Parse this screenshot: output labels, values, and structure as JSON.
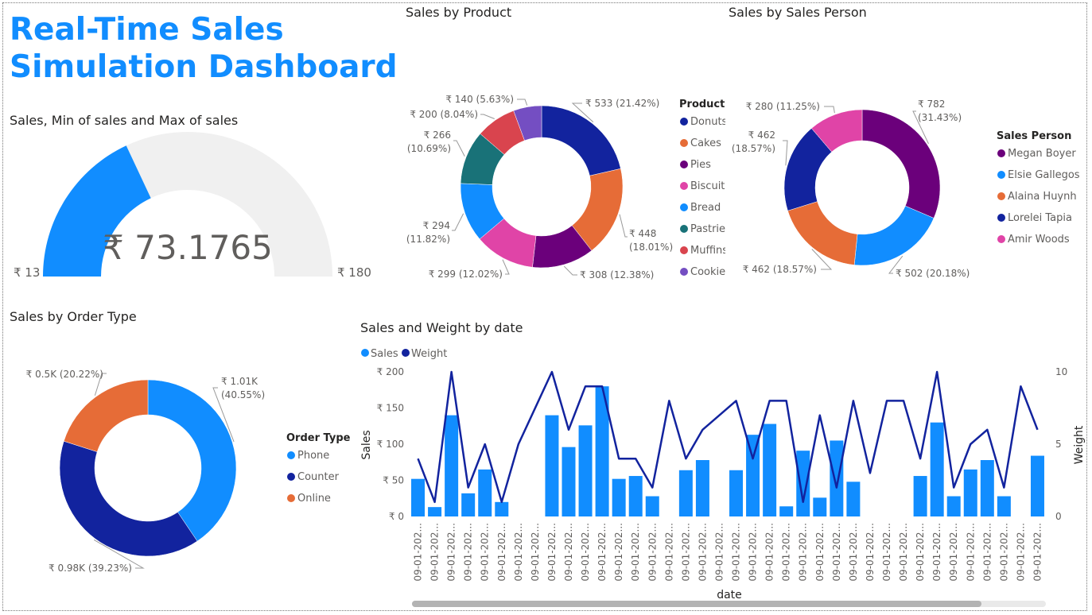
{
  "dashboard": {
    "title_line1": "Real-Time Sales",
    "title_line2": "Simulation Dashboard"
  },
  "visual_titles": {
    "gauge": "Sales, Min of sales and Max of sales",
    "product": "Sales by Product",
    "person": "Sales by Sales Person",
    "order": "Sales by Order Type",
    "combo": "Sales and Weight by date"
  },
  "colors": {
    "accent": "#118DFF",
    "track": "#F0F0F0",
    "title": "#118DFF"
  },
  "chart_data": [
    {
      "type": "gauge",
      "title": "Sales, Min of sales and Max of sales",
      "value": 73.1765,
      "min": 13,
      "max": 180,
      "value_label": "₹ 73.1765",
      "min_label": "₹ 13",
      "max_label": "₹ 180"
    },
    {
      "type": "pie",
      "title": "Sales by Product",
      "legend_title": "Product",
      "legend_position": "right",
      "slices": [
        {
          "name": "Donuts",
          "value": 533,
          "label": "₹ 533 (21.42%)",
          "color": "#12239E"
        },
        {
          "name": "Cakes",
          "value": 448,
          "label": "₹ 448 (18.01%)",
          "color": "#E66C37"
        },
        {
          "name": "Pies",
          "value": 308,
          "label": "₹ 308 (12.38%)",
          "color": "#6B007B"
        },
        {
          "name": "Biscuits",
          "value": 299,
          "label": "₹ 299 (12.02%)",
          "color": "#E044A7"
        },
        {
          "name": "Bread",
          "value": 294,
          "label": "₹ 294 (11.82%)",
          "color": "#118DFF"
        },
        {
          "name": "Pastries",
          "value": 266,
          "label": "₹ 266 (10.69%)",
          "color": "#197278"
        },
        {
          "name": "Muffins",
          "value": 200,
          "label": "₹ 200 (8.04%)",
          "color": "#D9444E"
        },
        {
          "name": "Cookies",
          "value": 140,
          "label": "₹ 140 (5.63%)",
          "color": "#744EC2"
        }
      ],
      "legend_labels": [
        "Donuts",
        "Cakes",
        "Pies",
        "Biscuits",
        "Bread",
        "Pastries",
        "Muffins",
        "Cookie"
      ]
    },
    {
      "type": "pie",
      "title": "Sales by Sales Person",
      "legend_title": "Sales Person",
      "legend_position": "right",
      "slices": [
        {
          "name": "Megan Boyer",
          "value": 782,
          "label": "₹ 782 (31.43%)",
          "color": "#6B007B"
        },
        {
          "name": "Elsie Gallegos",
          "value": 502,
          "label": "₹ 502 (20.18%)",
          "color": "#118DFF"
        },
        {
          "name": "Alaina Huynh",
          "value": 462,
          "label": "₹ 462 (18.57%)",
          "color": "#E66C37"
        },
        {
          "name": "Lorelei Tapia",
          "value": 462,
          "label": "₹ 462 (18.57%)",
          "color": "#12239E"
        },
        {
          "name": "Amir Woods",
          "value": 280,
          "label": "₹ 280 (11.25%)",
          "color": "#E044A7"
        }
      ]
    },
    {
      "type": "pie",
      "title": "Sales by Order Type",
      "legend_title": "Order Type",
      "legend_position": "right",
      "slices": [
        {
          "name": "Phone",
          "value": 1010,
          "label": "₹ 1.01K (40.55%)",
          "color": "#118DFF"
        },
        {
          "name": "Counter",
          "value": 980,
          "label": "₹ 0.98K (39.23%)",
          "color": "#12239E"
        },
        {
          "name": "Online",
          "value": 500,
          "label": "₹ 0.5K (20.22%)",
          "color": "#E66C37"
        }
      ]
    },
    {
      "type": "bar",
      "title": "Sales and Weight by date",
      "xlabel": "date",
      "ylabel": "Sales",
      "y2label": "Weight",
      "ylim": [
        0,
        200
      ],
      "y2lim": [
        0,
        10
      ],
      "yticks": [
        "₹ 0",
        "₹ 50",
        "₹ 100",
        "₹ 150",
        "₹ 200"
      ],
      "y2ticks": [
        "0",
        "5",
        "10"
      ],
      "category_label": "09-01-202...",
      "series": [
        {
          "name": "Sales",
          "kind": "bar",
          "color": "#118DFF",
          "values": [
            52,
            13,
            140,
            32,
            65,
            20,
            null,
            null,
            140,
            96,
            126,
            180,
            52,
            56,
            28,
            null,
            64,
            78,
            null,
            64,
            113,
            128,
            14,
            91,
            26,
            105,
            48,
            null,
            null,
            null,
            56,
            130,
            28,
            65,
            78,
            28,
            null,
            84
          ]
        },
        {
          "name": "Weight",
          "kind": "line",
          "color": "#12239E",
          "values": [
            4,
            1,
            10,
            2,
            5,
            1,
            5,
            10,
            6,
            9,
            9,
            4,
            4,
            2,
            8,
            4,
            6,
            8,
            4,
            8,
            8,
            1,
            7,
            2,
            8,
            3,
            8,
            8,
            4,
            10,
            2,
            5,
            6,
            2,
            9,
            6
          ]
        }
      ],
      "line_x_index": [
        0,
        1,
        2,
        3,
        4,
        5,
        6,
        8,
        9,
        10,
        11,
        12,
        13,
        14,
        15,
        16,
        17,
        19,
        20,
        21,
        22,
        23,
        24,
        25,
        26,
        27,
        28,
        29,
        30,
        31,
        32,
        33,
        34,
        35,
        36,
        37
      ],
      "legend_position": "top-left"
    }
  ]
}
